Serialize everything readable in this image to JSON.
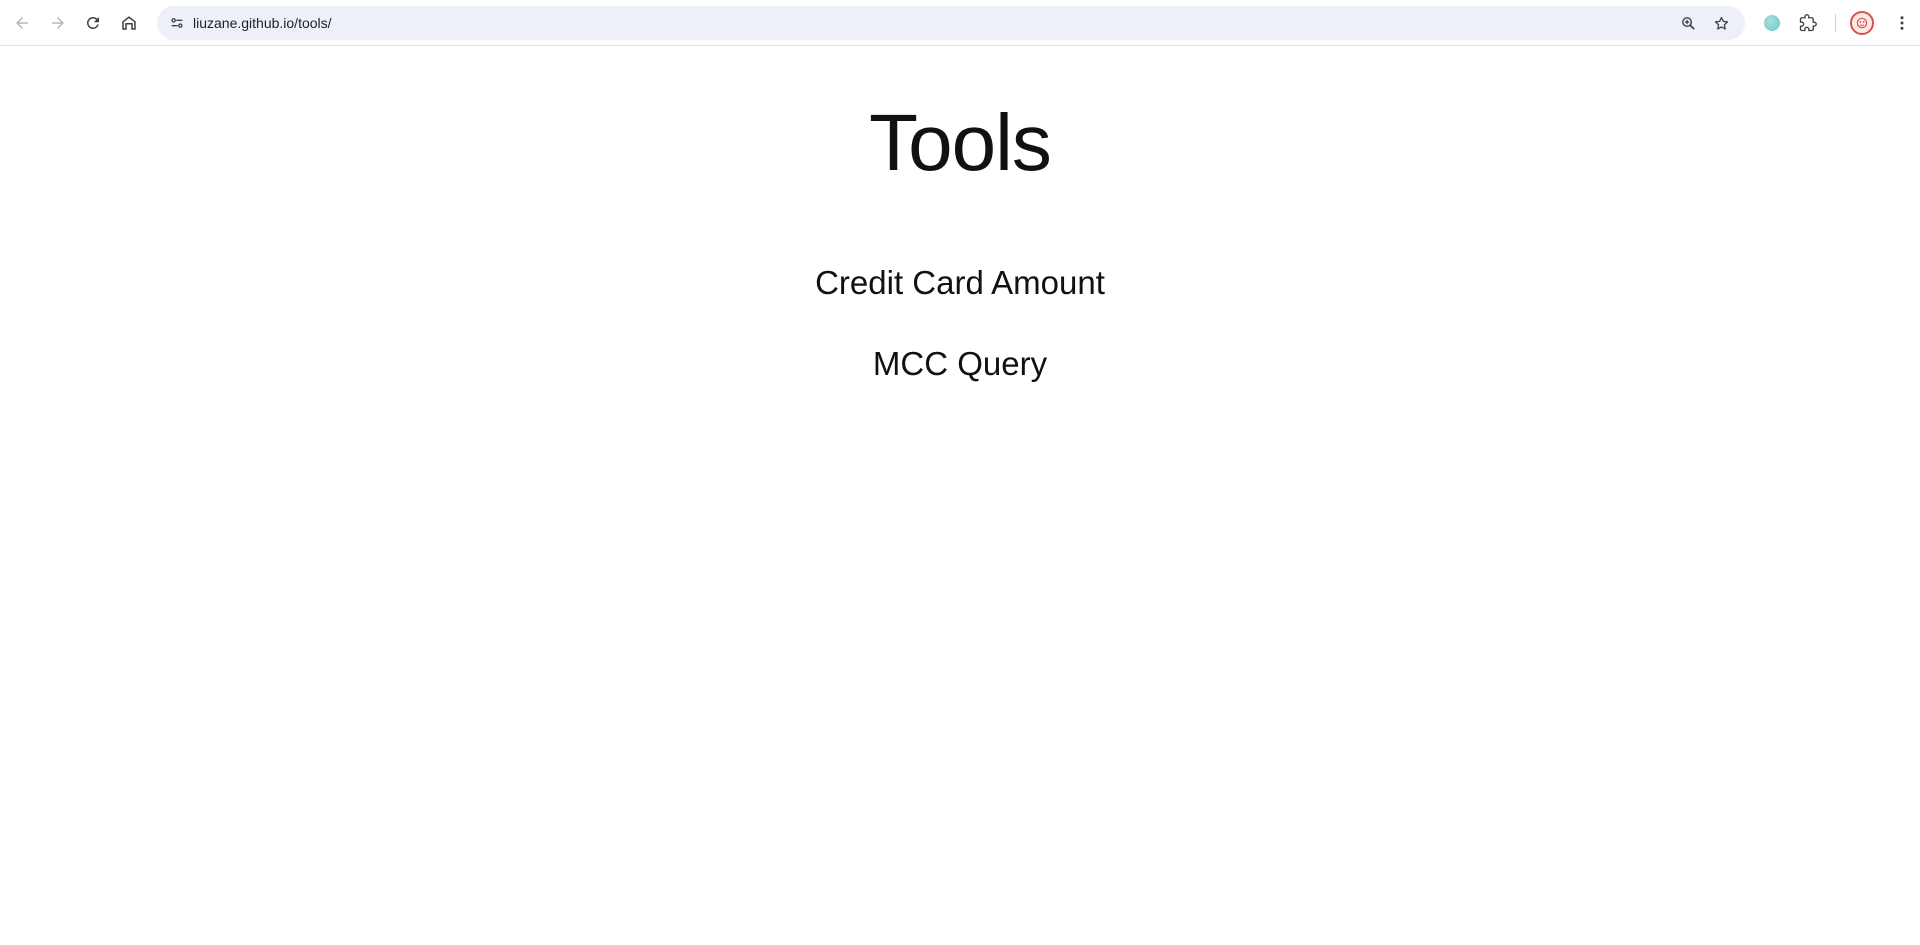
{
  "browser": {
    "url": "liuzane.github.io/tools/",
    "icons": {
      "back": "arrow-left-icon",
      "forward": "arrow-right-icon",
      "reload": "reload-icon",
      "home": "home-icon",
      "site_info": "tune-icon",
      "zoom": "zoom-icon",
      "bookmark": "star-icon",
      "extension": "extension-dot-icon",
      "extensions_menu": "puzzle-icon",
      "profile": "avatar-icon",
      "menu": "kebab-menu-icon"
    }
  },
  "page": {
    "title": "Tools",
    "links": [
      {
        "label": "Credit Card Amount"
      },
      {
        "label": "MCC Query"
      }
    ]
  }
}
